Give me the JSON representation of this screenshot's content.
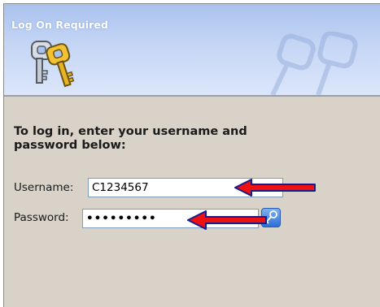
{
  "dialog": {
    "title": "Log On Required",
    "instructions": "To log in, enter your username and password below:"
  },
  "form": {
    "username_label": "Username:",
    "username_value": "C1234567",
    "password_label": "Password:",
    "password_value": "•••••••••"
  },
  "icons": {
    "banner_icon": "keys-icon",
    "submit_icon": "key-icon",
    "annotation": "red-arrow-icon"
  },
  "colors": {
    "banner_top": "#a9c2ee",
    "banner_bottom": "#dbe6fa",
    "panel_background": "#d8d2c8",
    "arrow_red": "#ee1111",
    "arrow_outline": "#1a1a8a"
  }
}
